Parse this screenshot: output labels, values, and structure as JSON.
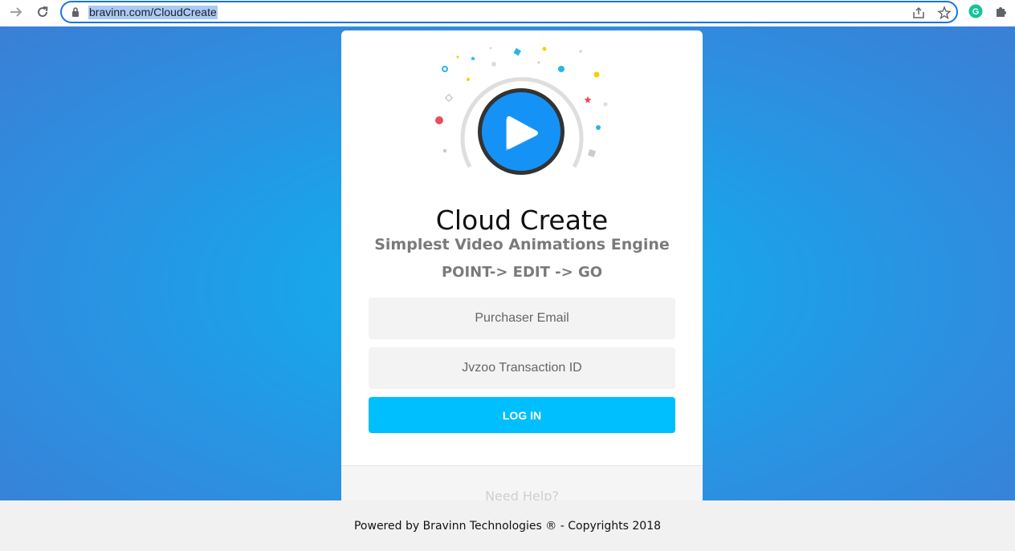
{
  "browser": {
    "url": "bravinn.com/CloudCreate",
    "back_icon": "arrow-right-icon",
    "reload_icon": "reload-icon",
    "share_icon": "share-icon",
    "star_icon": "star-icon",
    "grammarly_icon": "grammarly-icon",
    "extensions_icon": "puzzle-icon"
  },
  "card": {
    "logo_icon": "play-icon",
    "title": "Cloud Create",
    "subtitle": "Simplest Video Animations Engine",
    "tagline": "POINT-> EDIT -> GO",
    "email_placeholder": "Purchaser Email",
    "transaction_placeholder": "Jvzoo Transaction ID",
    "login_label": "LOG IN",
    "help_label": "Need Help?"
  },
  "footer": {
    "text": "Powered by Bravinn Technologies ® - Copyrights 2018"
  },
  "colors": {
    "accent": "#00bfff",
    "play_blue": "#1592f5",
    "background_center": "#14b2ee",
    "background_edge": "#3a7fd6"
  }
}
